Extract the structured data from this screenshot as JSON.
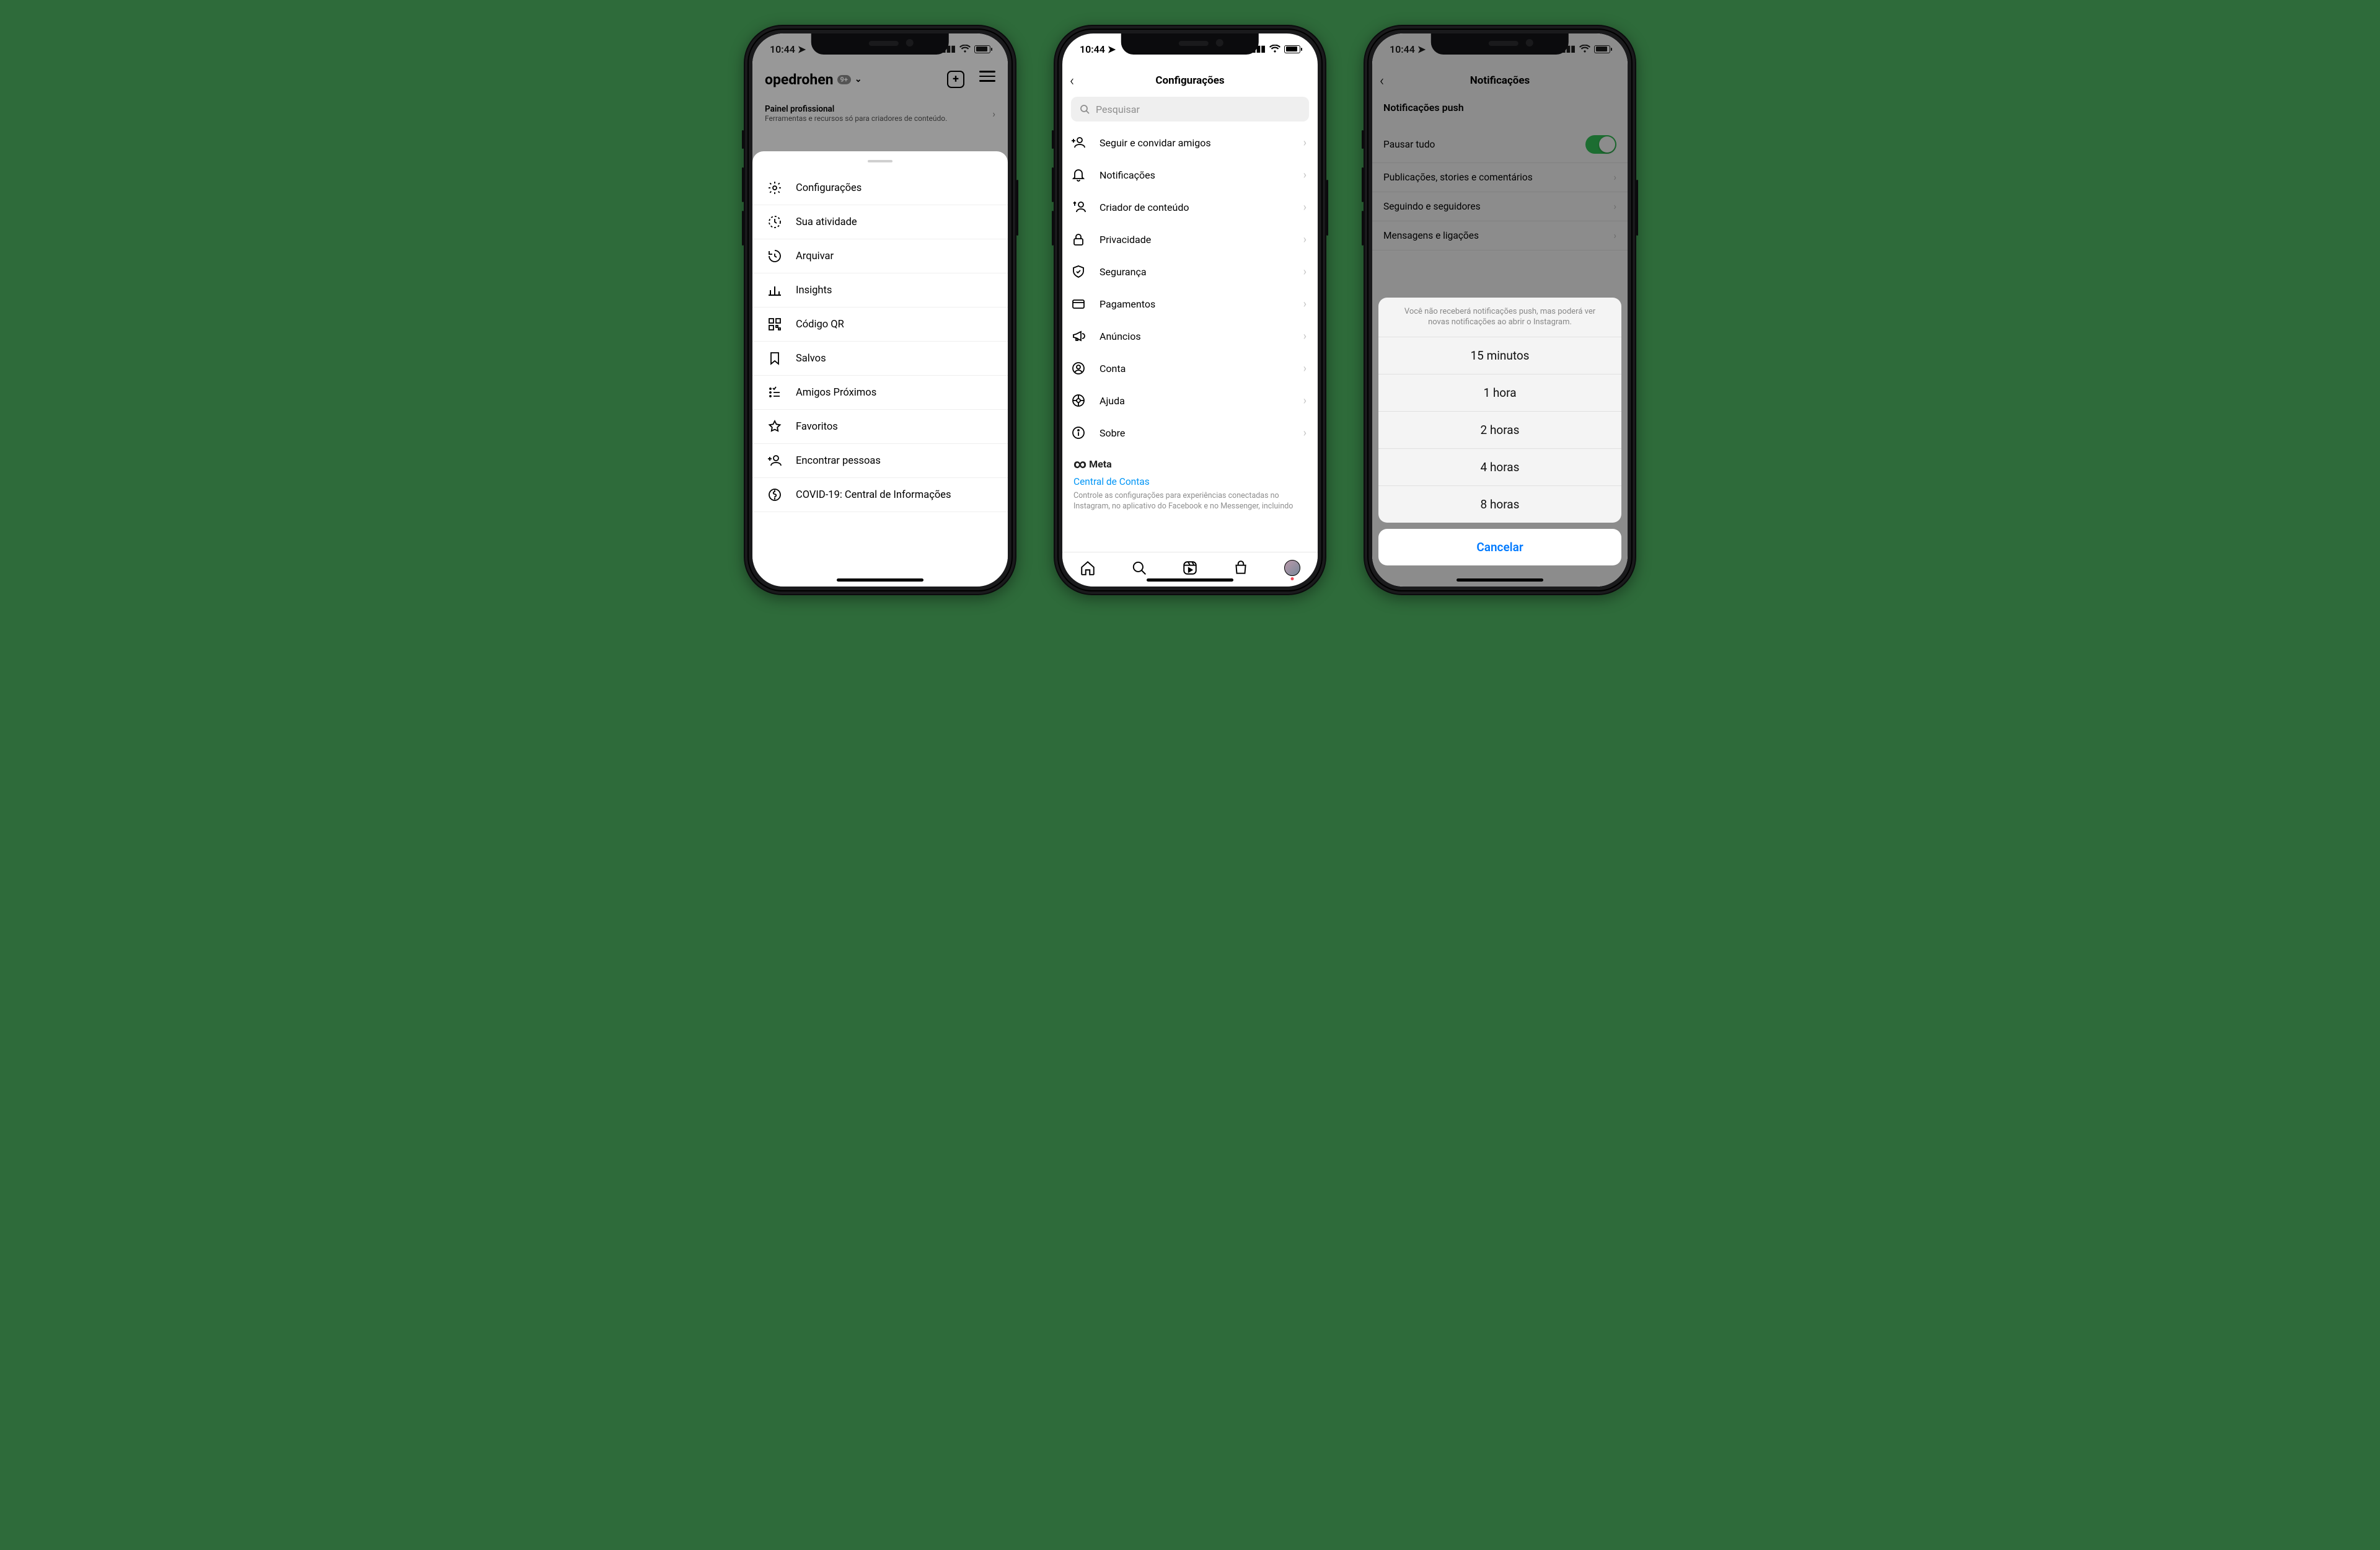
{
  "status": {
    "time": "10:44",
    "location_icon": "location-arrow"
  },
  "phone1": {
    "username": "opedrohen",
    "badge": "9+",
    "pro_panel_title": "Painel profissional",
    "pro_panel_sub": "Ferramentas e recursos só para criadores de conteúdo.",
    "menu": [
      {
        "label": "Configurações",
        "icon": "gear"
      },
      {
        "label": "Sua atividade",
        "icon": "activity"
      },
      {
        "label": "Arquivar",
        "icon": "archive"
      },
      {
        "label": "Insights",
        "icon": "chart"
      },
      {
        "label": "Código QR",
        "icon": "qr"
      },
      {
        "label": "Salvos",
        "icon": "bookmark"
      },
      {
        "label": "Amigos Próximos",
        "icon": "close-friends"
      },
      {
        "label": "Favoritos",
        "icon": "star"
      },
      {
        "label": "Encontrar pessoas",
        "icon": "add-person"
      },
      {
        "label": "COVID-19: Central de Informações",
        "icon": "covid"
      }
    ]
  },
  "phone2": {
    "title": "Configurações",
    "search_placeholder": "Pesquisar",
    "items": [
      {
        "label": "Seguir e convidar amigos",
        "icon": "add-person"
      },
      {
        "label": "Notificações",
        "icon": "bell"
      },
      {
        "label": "Criador de conteúdo",
        "icon": "creator"
      },
      {
        "label": "Privacidade",
        "icon": "lock"
      },
      {
        "label": "Segurança",
        "icon": "shield"
      },
      {
        "label": "Pagamentos",
        "icon": "card"
      },
      {
        "label": "Anúncios",
        "icon": "megaphone"
      },
      {
        "label": "Conta",
        "icon": "account"
      },
      {
        "label": "Ajuda",
        "icon": "help"
      },
      {
        "label": "Sobre",
        "icon": "info"
      }
    ],
    "meta_label": "Meta",
    "accounts_center": "Central de Contas",
    "meta_desc": "Controle as configurações para experiências conectadas no Instagram, no aplicativo do Facebook e no Messenger, incluindo"
  },
  "phone3": {
    "title": "Notificações",
    "section": "Notificações push",
    "rows": [
      {
        "label": "Pausar tudo",
        "toggle": true
      },
      {
        "label": "Publicações, stories e comentários",
        "chevron": true
      },
      {
        "label": "Seguindo e seguidores",
        "chevron": true
      },
      {
        "label": "Mensagens e ligações",
        "chevron": true
      }
    ],
    "sheet_desc": "Você não receberá notificações push, mas poderá ver novas notificações ao abrir o Instagram.",
    "options": [
      "15 minutos",
      "1 hora",
      "2 horas",
      "4 horas",
      "8 horas"
    ],
    "cancel": "Cancelar"
  }
}
